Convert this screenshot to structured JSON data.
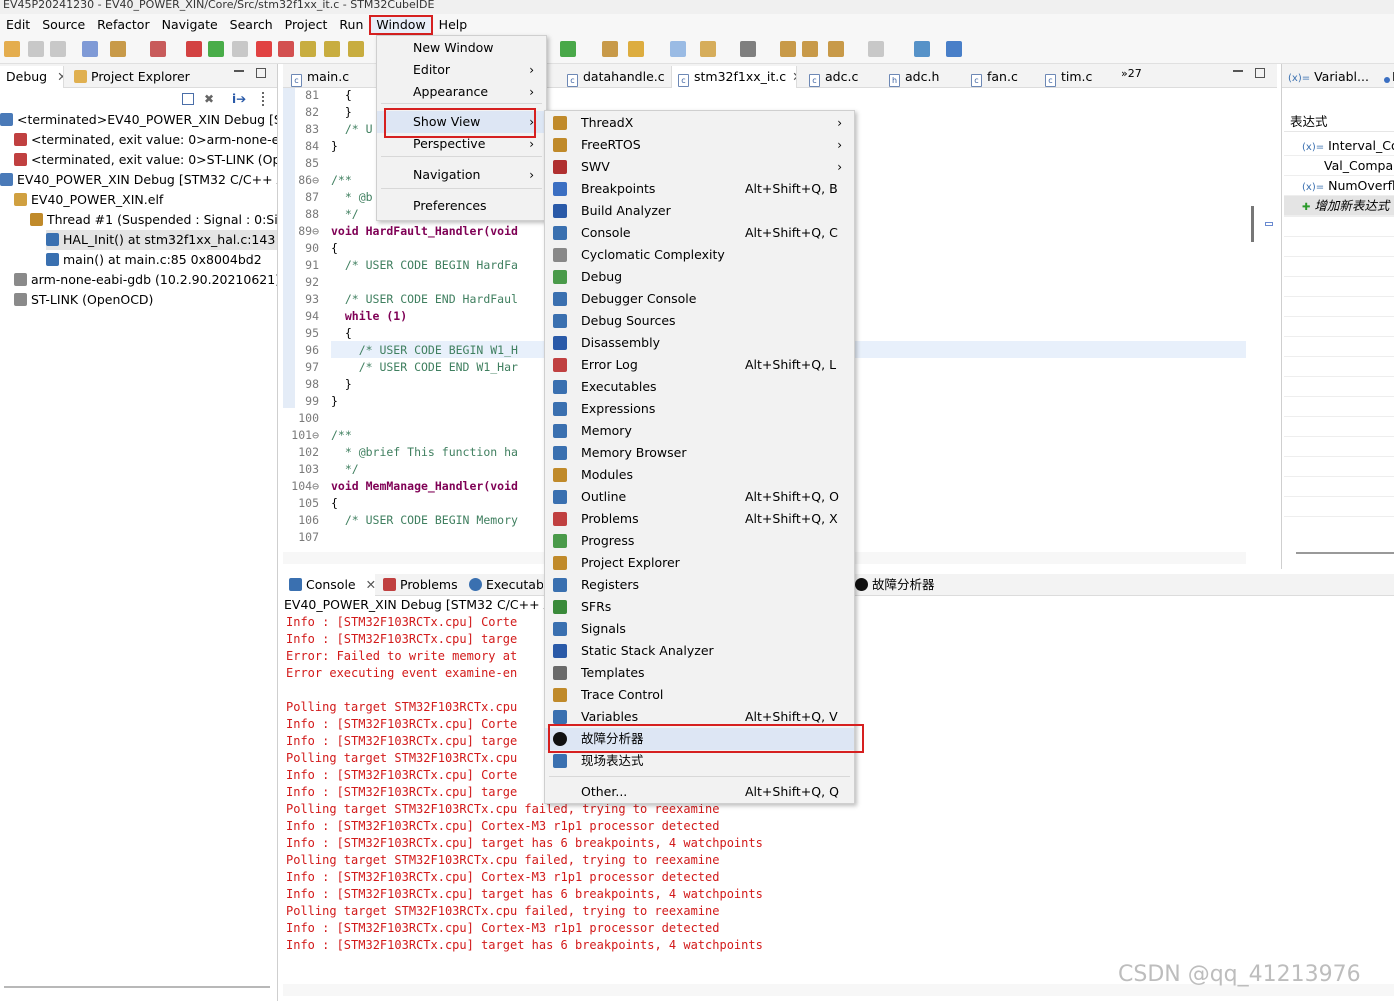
{
  "titlebar": {
    "text": "EV45P20241230 - EV40_POWER_XIN/Core/Src/stm32f1xx_it.c - STM32CubeIDE"
  },
  "menubar": [
    "Edit",
    "Source",
    "Refactor",
    "Navigate",
    "Search",
    "Project",
    "Run",
    "Window",
    "Help"
  ],
  "left_panel": {
    "tabs": [
      "Debug",
      "Project Explorer"
    ],
    "tree": [
      {
        "text": "<terminated>EV40_POWER_XIN Debug [STM",
        "indent": 0
      },
      {
        "text": "<terminated, exit value: 0>arm-none-eab",
        "indent": 1
      },
      {
        "text": "<terminated, exit value: 0>ST-LINK (Oper",
        "indent": 1
      },
      {
        "text": "EV40_POWER_XIN Debug [STM32 C/C++ Ap",
        "indent": 0
      },
      {
        "text": "EV40_POWER_XIN.elf",
        "indent": 1
      },
      {
        "text": "Thread #1 (Suspended : Signal : 0:Sign",
        "indent": 2
      },
      {
        "text": "HAL_Init() at stm32f1xx_hal.c:143 0x8",
        "indent": 3
      },
      {
        "text": "main() at main.c:85 0x8004bd2",
        "indent": 3
      },
      {
        "text": "arm-none-eabi-gdb (10.2.90.20210621)",
        "indent": 1
      },
      {
        "text": "ST-LINK (OpenOCD)",
        "indent": 1
      }
    ]
  },
  "editor": {
    "tabs": [
      "main.c",
      "datahandle.c",
      "stm32f1xx_it.c",
      "adc.c",
      "adc.h",
      "fan.c",
      "tim.c"
    ],
    "overflow": "»27",
    "line_numbers": [
      "81",
      "82",
      "83",
      "84",
      "85",
      "86⊖",
      "87",
      "88",
      "89⊖",
      "90",
      "91",
      "92",
      "93",
      "94",
      "95",
      "96",
      "97",
      "98",
      "99",
      "100",
      "101⊖",
      "102",
      "103",
      "104⊖",
      "105",
      "106",
      "107"
    ],
    "lines": [
      "  {",
      "  }",
      "  /* U",
      "}",
      "",
      "/**",
      "  * @b",
      "  */",
      "void HardFault_Handler(void",
      "{",
      "  /* USER CODE BEGIN HardFa",
      "",
      "  /* USER CODE END HardFaul",
      "  while (1)",
      "  {",
      "    /* USER CODE BEGIN W1_H",
      "    /* USER CODE END W1_Har",
      "  }",
      "}",
      "",
      "/**",
      "  * @brief This function ha",
      "  */",
      "void MemManage_Handler(void",
      "{",
      "  /* USER CODE BEGIN Memory",
      ""
    ]
  },
  "right_panel": {
    "tab": "Variabl...",
    "tab2": "B",
    "header": "表达式",
    "items": [
      "Interval_Com",
      "Val_Compar",
      "NumOverflo",
      "增加新表达式"
    ]
  },
  "console": {
    "tabs": [
      "Console",
      "Problems",
      "Executabl"
    ],
    "extra_tab": "故障分析器",
    "header": "EV40_POWER_XIN Debug [STM32 C/C++ Ap",
    "lines": [
      "Info : [STM32F103RCTx.cpu] Corte",
      "Info : [STM32F103RCTx.cpu] targe",
      "Error: Failed to write memory at",
      "Error executing event examine-en",
      "",
      "Polling target STM32F103RCTx.cpu",
      "Info : [STM32F103RCTx.cpu] Corte",
      "Info : [STM32F103RCTx.cpu] targe",
      "Polling target STM32F103RCTx.cpu",
      "Info : [STM32F103RCTx.cpu] Corte",
      "Info : [STM32F103RCTx.cpu] targe",
      "Polling target STM32F103RCTx.cpu failed, trying to reexamine",
      "Info : [STM32F103RCTx.cpu] Cortex-M3 r1p1 processor detected",
      "Info : [STM32F103RCTx.cpu] target has 6 breakpoints, 4 watchpoints",
      "Polling target STM32F103RCTx.cpu failed, trying to reexamine",
      "Info : [STM32F103RCTx.cpu] Cortex-M3 r1p1 processor detected",
      "Info : [STM32F103RCTx.cpu] target has 6 breakpoints, 4 watchpoints",
      "Polling target STM32F103RCTx.cpu failed, trying to reexamine",
      "Info : [STM32F103RCTx.cpu] Cortex-M3 r1p1 processor detected",
      "Info : [STM32F103RCTx.cpu] target has 6 breakpoints, 4 watchpoints"
    ]
  },
  "window_menu": [
    {
      "label": "New Window",
      "sub": false
    },
    {
      "label": "Editor",
      "sub": true
    },
    {
      "label": "Appearance",
      "sub": true
    },
    {
      "label": "Show View",
      "sub": true,
      "highlight": true
    },
    {
      "label": "Perspective",
      "sub": true
    },
    {
      "label": "Navigation",
      "sub": true
    },
    {
      "label": "Preferences",
      "sub": false
    }
  ],
  "show_view_menu": [
    {
      "label": "ThreadX",
      "acc": "",
      "sub": true,
      "icon": "threadx-icon",
      "color": "#c08a2a"
    },
    {
      "label": "FreeRTOS",
      "acc": "",
      "sub": true,
      "icon": "freertos-icon",
      "color": "#c08a2a"
    },
    {
      "label": "SWV",
      "acc": "",
      "sub": true,
      "icon": "swv-icon",
      "color": "#b03030"
    },
    {
      "label": "Breakpoints",
      "acc": "Alt+Shift+Q, B",
      "sub": false,
      "icon": "breakpoints-icon",
      "color": "#3b6fc2"
    },
    {
      "label": "Build Analyzer",
      "acc": "",
      "sub": false,
      "icon": "build-analyzer-icon",
      "color": "#2a5aa8"
    },
    {
      "label": "Console",
      "acc": "Alt+Shift+Q, C",
      "sub": false,
      "icon": "console-icon",
      "color": "#3a70b0"
    },
    {
      "label": "Cyclomatic Complexity",
      "acc": "",
      "sub": false,
      "icon": "cyclomatic-icon",
      "color": "#888888"
    },
    {
      "label": "Debug",
      "acc": "",
      "sub": false,
      "icon": "debug-icon",
      "color": "#4a9a4a"
    },
    {
      "label": "Debugger Console",
      "acc": "",
      "sub": false,
      "icon": "debugger-console-icon",
      "color": "#3a70b0"
    },
    {
      "label": "Debug Sources",
      "acc": "",
      "sub": false,
      "icon": "debug-sources-icon",
      "color": "#3a70b0"
    },
    {
      "label": "Disassembly",
      "acc": "",
      "sub": false,
      "icon": "disassembly-icon",
      "color": "#2a5aa8"
    },
    {
      "label": "Error Log",
      "acc": "Alt+Shift+Q, L",
      "sub": false,
      "icon": "error-log-icon",
      "color": "#c04040"
    },
    {
      "label": "Executables",
      "acc": "",
      "sub": false,
      "icon": "executables-icon",
      "color": "#3a70b0"
    },
    {
      "label": "Expressions",
      "acc": "",
      "sub": false,
      "icon": "expressions-icon",
      "color": "#3a70b0"
    },
    {
      "label": "Memory",
      "acc": "",
      "sub": false,
      "icon": "memory-icon",
      "color": "#3a70b0"
    },
    {
      "label": "Memory Browser",
      "acc": "",
      "sub": false,
      "icon": "memory-browser-icon",
      "color": "#3a70b0"
    },
    {
      "label": "Modules",
      "acc": "",
      "sub": false,
      "icon": "modules-icon",
      "color": "#c08a2a"
    },
    {
      "label": "Outline",
      "acc": "Alt+Shift+Q, O",
      "sub": false,
      "icon": "outline-icon",
      "color": "#3a70b0"
    },
    {
      "label": "Problems",
      "acc": "Alt+Shift+Q, X",
      "sub": false,
      "icon": "problems-icon",
      "color": "#c04040"
    },
    {
      "label": "Progress",
      "acc": "",
      "sub": false,
      "icon": "progress-icon",
      "color": "#4a9a4a"
    },
    {
      "label": "Project Explorer",
      "acc": "",
      "sub": false,
      "icon": "project-explorer-icon",
      "color": "#c08a2a"
    },
    {
      "label": "Registers",
      "acc": "",
      "sub": false,
      "icon": "registers-icon",
      "color": "#3a70b0"
    },
    {
      "label": "SFRs",
      "acc": "",
      "sub": false,
      "icon": "sfrs-icon",
      "color": "#3a8a3a"
    },
    {
      "label": "Signals",
      "acc": "",
      "sub": false,
      "icon": "signals-icon",
      "color": "#3a70b0"
    },
    {
      "label": "Static Stack Analyzer",
      "acc": "",
      "sub": false,
      "icon": "static-stack-icon",
      "color": "#2a5aa8"
    },
    {
      "label": "Templates",
      "acc": "",
      "sub": false,
      "icon": "templates-icon",
      "color": "#6a6a6a"
    },
    {
      "label": "Trace Control",
      "acc": "",
      "sub": false,
      "icon": "trace-control-icon",
      "color": "#c08a2a"
    },
    {
      "label": "Variables",
      "acc": "Alt+Shift+Q, V",
      "sub": false,
      "icon": "variables-icon",
      "color": "#3a70b0"
    },
    {
      "label": "故障分析器",
      "acc": "",
      "sub": false,
      "icon": "fault-analyzer-icon",
      "color": "#111111",
      "highlight": true
    },
    {
      "label": "现场表达式",
      "acc": "",
      "sub": false,
      "icon": "live-expressions-icon",
      "color": "#3a70b0"
    },
    {
      "label": "Other...",
      "acc": "Alt+Shift+Q, Q",
      "sub": false,
      "icon": "",
      "color": ""
    }
  ],
  "watermark": "CSDN @qq_41213976",
  "colors": {
    "highlight_red": "#d62020",
    "console_red": "#d21a1a",
    "menu_bg": "#f2f2f2"
  }
}
